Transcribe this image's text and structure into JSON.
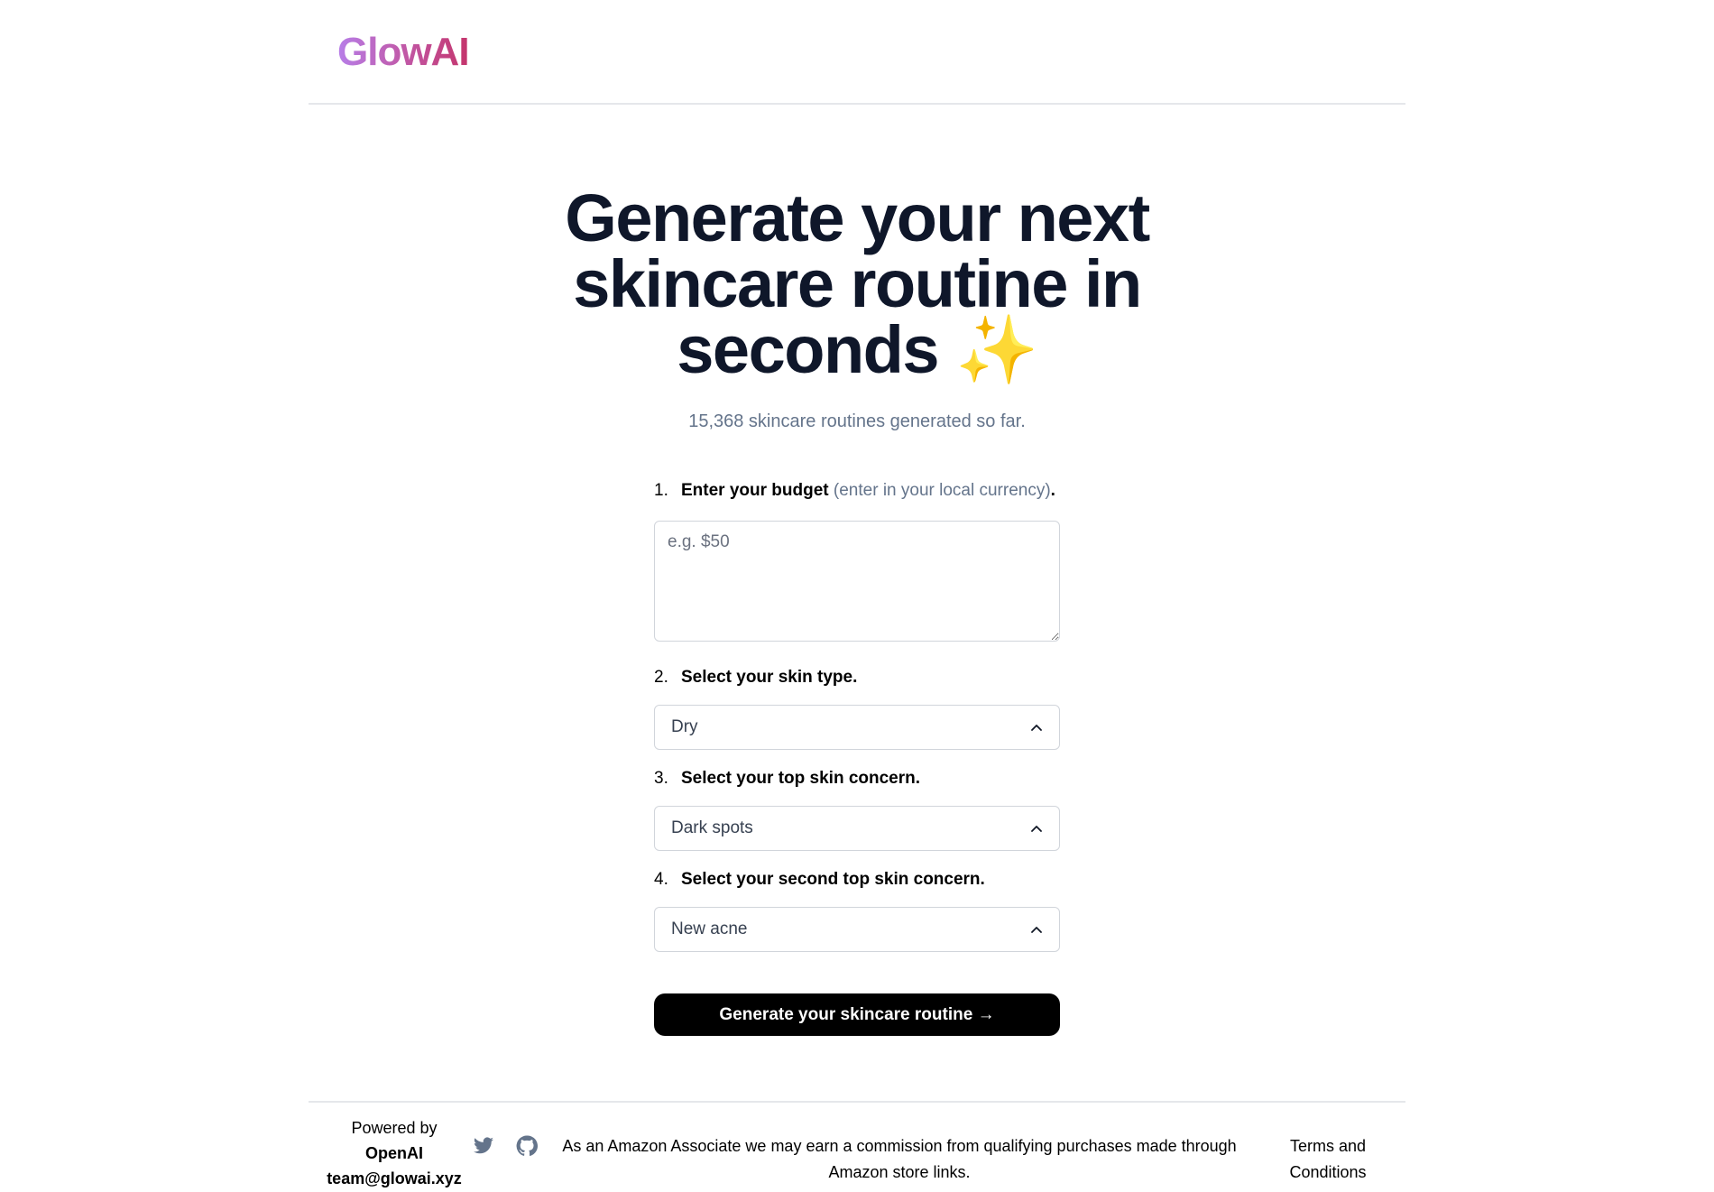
{
  "header": {
    "logo": "GlowAI",
    "logo_gradient": [
      "#b77ee8",
      "#c4346b"
    ]
  },
  "hero": {
    "headline": "Generate your next skincare routine in seconds",
    "headline_emoji": "✨",
    "counter": "15,368 skincare routines generated so far."
  },
  "form": {
    "steps": [
      {
        "number": "1.",
        "label": "Enter your budget",
        "hint": "(enter in your local currency)",
        "suffix": "."
      },
      {
        "number": "2.",
        "label": "Select your skin type."
      },
      {
        "number": "3.",
        "label": "Select your top skin concern."
      },
      {
        "number": "4.",
        "label": "Select your second top skin concern."
      }
    ],
    "budget": {
      "value": "",
      "placeholder": "e.g. $50"
    },
    "skin_type": {
      "selected": "Dry",
      "icon": "chevron-up-icon"
    },
    "top_concern": {
      "selected": "Dark spots",
      "icon": "chevron-up-icon"
    },
    "second_concern": {
      "selected": "New acne",
      "icon": "chevron-up-icon"
    },
    "submit_label": "Generate your skincare routine →"
  },
  "footer": {
    "powered_by": "Powered by",
    "provider": "OpenAI",
    "email": "team@glowai.xyz",
    "social": [
      {
        "name": "twitter-icon"
      },
      {
        "name": "github-icon"
      }
    ],
    "icon_color": "#64748b",
    "disclaimer": "As an Amazon Associate we may earn a commission from qualifying purchases made through Amazon store links.",
    "terms_link": "Terms and Conditions"
  }
}
